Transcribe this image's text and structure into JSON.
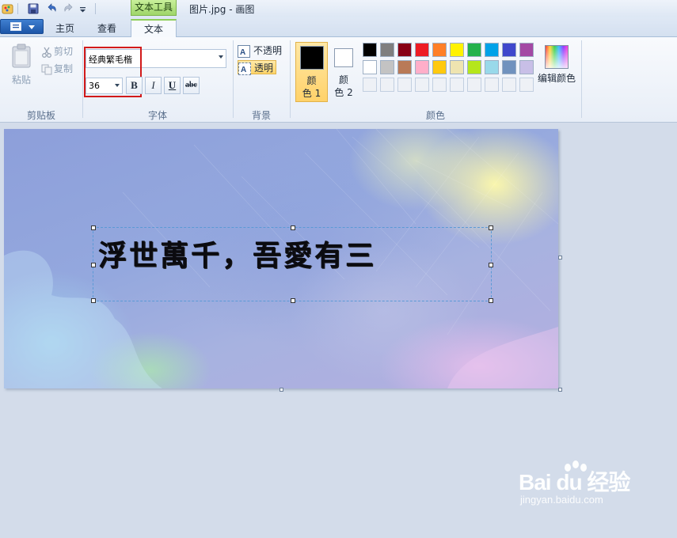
{
  "window": {
    "title": "图片.jpg - 画图",
    "context_tab_header": "文本工具"
  },
  "tabs": [
    {
      "label": "主页",
      "active": false
    },
    {
      "label": "查看",
      "active": false
    },
    {
      "label": "文本",
      "active": true
    }
  ],
  "clipboard": {
    "paste_label": "粘贴",
    "cut_label": "剪切",
    "copy_label": "复制",
    "group_label": "剪贴板"
  },
  "font": {
    "name": "经典繁毛楷",
    "size": "36",
    "bold_label": "B",
    "italic_label": "I",
    "underline_label": "U",
    "strike_label": "abc",
    "group_label": "字体"
  },
  "background": {
    "opaque_label": "不透明",
    "transparent_label": "透明",
    "selected": "transparent",
    "group_label": "背景"
  },
  "colors": {
    "color1_label": "颜\n色 1",
    "color1_line1": "颜",
    "color1_line2": "色 1",
    "color1_value": "#000000",
    "color2_line1": "颜",
    "color2_line2": "色 2",
    "color2_value": "#ffffff",
    "edit_label": "编辑颜色",
    "group_label": "颜色",
    "palette_row1": [
      "#000000",
      "#7f7f7f",
      "#880015",
      "#ed1c24",
      "#ff7f27",
      "#fff200",
      "#22b14c",
      "#00a2e8",
      "#3f48cc",
      "#a349a4"
    ],
    "palette_row2": [
      "#ffffff",
      "#c3c3c3",
      "#b97a57",
      "#ffaec9",
      "#ffc90e",
      "#efe4b0",
      "#b5e61d",
      "#99d9ea",
      "#7092be",
      "#c8bfe7"
    ],
    "palette_row3": [
      "#eef1f6",
      "#eef1f6",
      "#eef1f6",
      "#eef1f6",
      "#eef1f6",
      "#eef1f6",
      "#eef1f6",
      "#eef1f6",
      "#eef1f6",
      "#eef1f6"
    ]
  },
  "canvas": {
    "text": "浮世萬千，吾愛有三"
  },
  "watermark": {
    "brand": "Bai du 经验",
    "url": "jingyan.baidu.com"
  }
}
